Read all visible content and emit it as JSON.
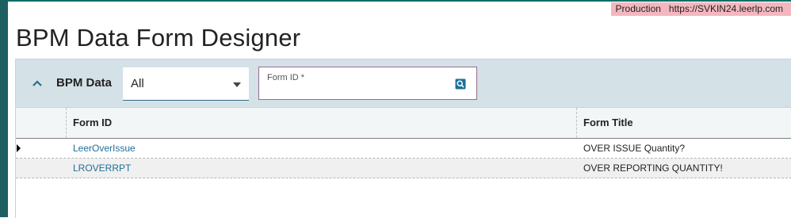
{
  "environment": {
    "label": "Production",
    "url": "https://SVKIN24.leerlp.com"
  },
  "page": {
    "title": "BPM Data Form Designer"
  },
  "toolbar": {
    "section_label": "BPM Data",
    "filter_value": "All",
    "form_id_label": "Form ID *",
    "form_id_value": ""
  },
  "grid": {
    "columns": [
      "Form ID",
      "Form Title"
    ],
    "rows": [
      {
        "form_id": "LeerOverIssue",
        "form_title": "OVER ISSUE Quantity?"
      },
      {
        "form_id": "LROVERRPT",
        "form_title": "OVER REPORTING QUANTITY!"
      }
    ]
  },
  "icons": {
    "collapse": "chevron-up-icon",
    "dropdown": "caret-down-icon",
    "search": "search-icon",
    "row_indicator": "row-pointer-icon"
  },
  "colors": {
    "accent": "#1e5f62",
    "toolbar_bg": "#d4e1e7",
    "link": "#1d6f98",
    "env_badge": "#f4b7bf"
  }
}
